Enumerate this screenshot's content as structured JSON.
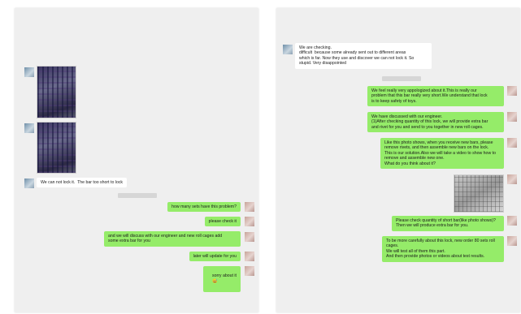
{
  "left_chat": {
    "timestamp": "",
    "received": {
      "lock_msg": "We can not lock it.  The bar too short to lock"
    },
    "sent": [
      "how many sets have this problem?",
      "please check it",
      "and we will discuss with our engineer and new roll cages add\nsome extra bar for you",
      "later will update for you",
      "sorry about it"
    ],
    "emoji": "😅"
  },
  "right_chat": {
    "timestamp": "",
    "received": {
      "checking_msg": "We are checking.\ndifficult  because some already sent out to different areas\nwhich is far. Now they use and discover we can not lock it. So\nstupid. Very disappointed"
    },
    "sent": [
      "We feel really very appologized about it.This is really our\nproblem that this bar really very short.We understand that lock\nis to keep safety of toys.",
      "We have discussed with our engineer.\n(1)After checking quantity of this lock, we will provide extra bar\nand rivet for you and send to you together in new roll cages.",
      "Like this photo shows, when you receive new bars, please\nremove rivets, and then assemble new bars on the lock.\nThis is our solution.Also we will take a video to show how to\nremove and assemble new one.\nWhat do you think about it?",
      "Please check quantity of short bar(like photo shows)?\nThen we will produce extra bar for you.",
      "To be more carefully about this lock, new order 80 sets roll\ncages.\nWe will test all of them this part.\nAnd then provide photos or videos about test results."
    ]
  }
}
